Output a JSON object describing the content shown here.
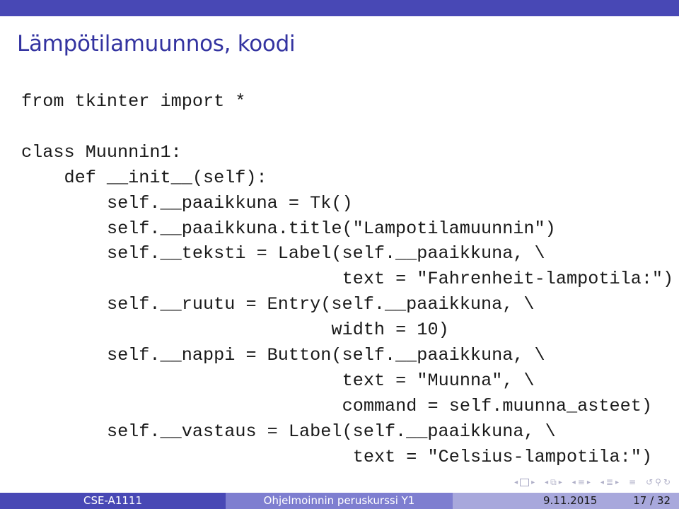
{
  "slide": {
    "title": "Lämpötilamuunnos, koodi",
    "code_lines": [
      {
        "indent": 0,
        "text": "from tkinter import *"
      },
      {
        "indent": 0,
        "text": ""
      },
      {
        "indent": 0,
        "text": "class Muunnin1:"
      },
      {
        "indent": 4,
        "text": "def __init__(self):"
      },
      {
        "indent": 8,
        "text": "self.__paaikkuna = Tk()"
      },
      {
        "indent": 8,
        "text": "self.__paaikkuna.title(\"Lampotilamuunnin\")"
      },
      {
        "indent": 8,
        "text": "self.__teksti = Label(self.__paaikkuna, \\"
      },
      {
        "indent": 30,
        "text": "text = \"Fahrenheit-lampotila:\")"
      },
      {
        "indent": 8,
        "text": "self.__ruutu = Entry(self.__paaikkuna, \\"
      },
      {
        "indent": 29,
        "text": "width = 10)"
      },
      {
        "indent": 8,
        "text": "self.__nappi = Button(self.__paaikkuna, \\"
      },
      {
        "indent": 30,
        "text": "text = \"Muunna\", \\"
      },
      {
        "indent": 30,
        "text": "command = self.muunna_asteet)"
      },
      {
        "indent": 8,
        "text": "self.__vastaus = Label(self.__paaikkuna, \\"
      },
      {
        "indent": 31,
        "text": "text = \"Celsius-lampotila:\")"
      }
    ]
  },
  "navigation": {
    "icons": [
      "nav-frame-icon",
      "nav-subsection-icon",
      "nav-section-icon",
      "nav-presentation-icon",
      "nav-align-icon",
      "nav-search-icon"
    ]
  },
  "footer": {
    "course": "CSE-A1111",
    "course_title": "Ohjelmoinnin peruskurssi Y1",
    "date": "9.11.2015",
    "page": "17 / 32"
  },
  "colors": {
    "theme_dark": "#4848b5",
    "theme_mid": "#7e7ed0",
    "theme_light": "#a8a8dc",
    "title_text": "#3333a0"
  }
}
